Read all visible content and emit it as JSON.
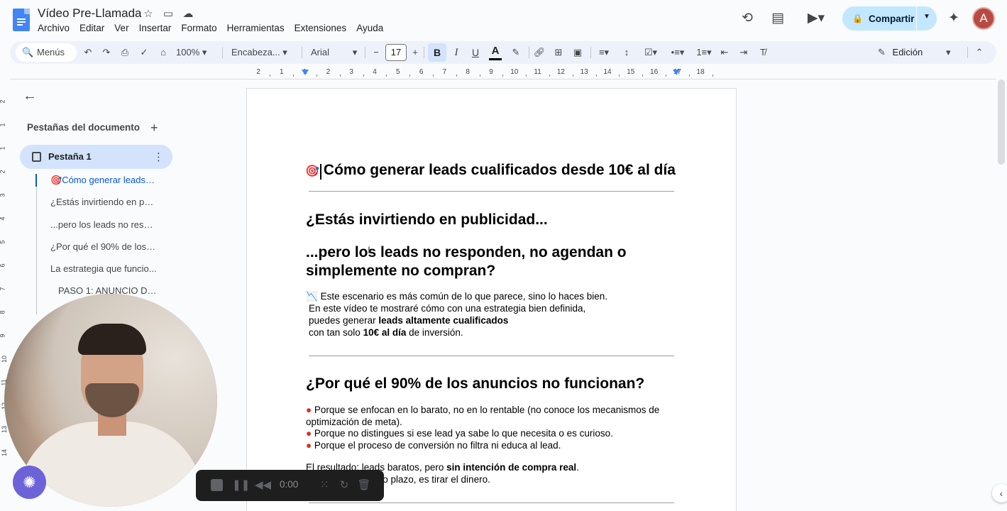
{
  "document": {
    "title": "Vídeo Pre-Llamada"
  },
  "menu": [
    "Archivo",
    "Editar",
    "Ver",
    "Insertar",
    "Formato",
    "Herramientas",
    "Extensiones",
    "Ayuda"
  ],
  "header": {
    "share_label": "Compartir",
    "avatar_letter": "A"
  },
  "toolbar": {
    "search_label": "Menús",
    "zoom": "100%",
    "style": "Encabeza...",
    "font": "Arial",
    "font_size": "17",
    "mode_label": "Edición"
  },
  "ruler": {
    "numbers": [
      "2",
      "1",
      "1",
      "2",
      "3",
      "4",
      "5",
      "6",
      "7",
      "8",
      "9",
      "10",
      "11",
      "12",
      "13",
      "14",
      "15",
      "16",
      "17",
      "18"
    ]
  },
  "vruler": {
    "numbers": [
      "2",
      "1",
      "1",
      "2",
      "3",
      "4",
      "5",
      "6",
      "7",
      "8",
      "9",
      "10",
      "11",
      "12",
      "13",
      "14"
    ]
  },
  "sidebar": {
    "title": "Pestañas del documento",
    "tab_label": "Pestaña 1",
    "outline": [
      "Cómo generar leads cualificados desde 10€ al día",
      "¿Estás invirtiendo en publicidad...",
      "...pero los leads no responden, no agendan o simplemente no compran?",
      "¿Por qué el 90% de los anuncios no funcionan?",
      "La estrategia que funciona",
      "PASO 1: ANUNCIO DE ATRACCIÓN"
    ],
    "outline_display": [
      "Cómo generar leads cu...",
      "¿Estás invirtiendo en pub...",
      "...pero los leads no respo...",
      "¿Por qué el 90% de los a...",
      "La estrategia que funcio...",
      "PASO 1: ANUNCIO DE A..."
    ]
  },
  "page": {
    "title": "Cómo generar leads cualificados desde 10€ al día",
    "h2_a": "¿Estás invirtiendo en publicidad...",
    "h2_b_line1": "...pero los leads no responden, no agendan o",
    "h2_b_line2": "simplemente no compran?",
    "para1_line1": "Este escenario es más común de lo que parece, sino lo haces bien.",
    "para1_line2": "En este vídeo te mostraré cómo con una estrategia bien definida,",
    "para1_line3_a": "puedes generar ",
    "para1_line3_b": "leads altamente cualificados",
    "para1_line4_a": "con tan solo ",
    "para1_line4_b": "10€ al día",
    "para1_line4_c": " de inversión.",
    "h2_c": "¿Por qué el 90% de los anuncios no funcionan?",
    "bullet1_line1": "Porque se enfocan en lo barato, no en lo rentable (no conoce los mecanismos de",
    "bullet1_line2": "optimización de meta).",
    "bullet2": "Porque no distingues si ese lead ya sabe lo que necesita o es curioso.",
    "bullet3": "Porque el proceso de conversión no filtra ni educa al lead.",
    "result_a": "El resultado: leads baratos, pero ",
    "result_b": "sin intención de compra real",
    "result_c": ".",
    "result2": "...o plazo, es tirar el dinero."
  },
  "recorder": {
    "time": "0:00"
  },
  "colors": {
    "accent": "#0b57d0",
    "share_bg": "#c2e7ff",
    "recorder_badge": "#6c63d9"
  }
}
